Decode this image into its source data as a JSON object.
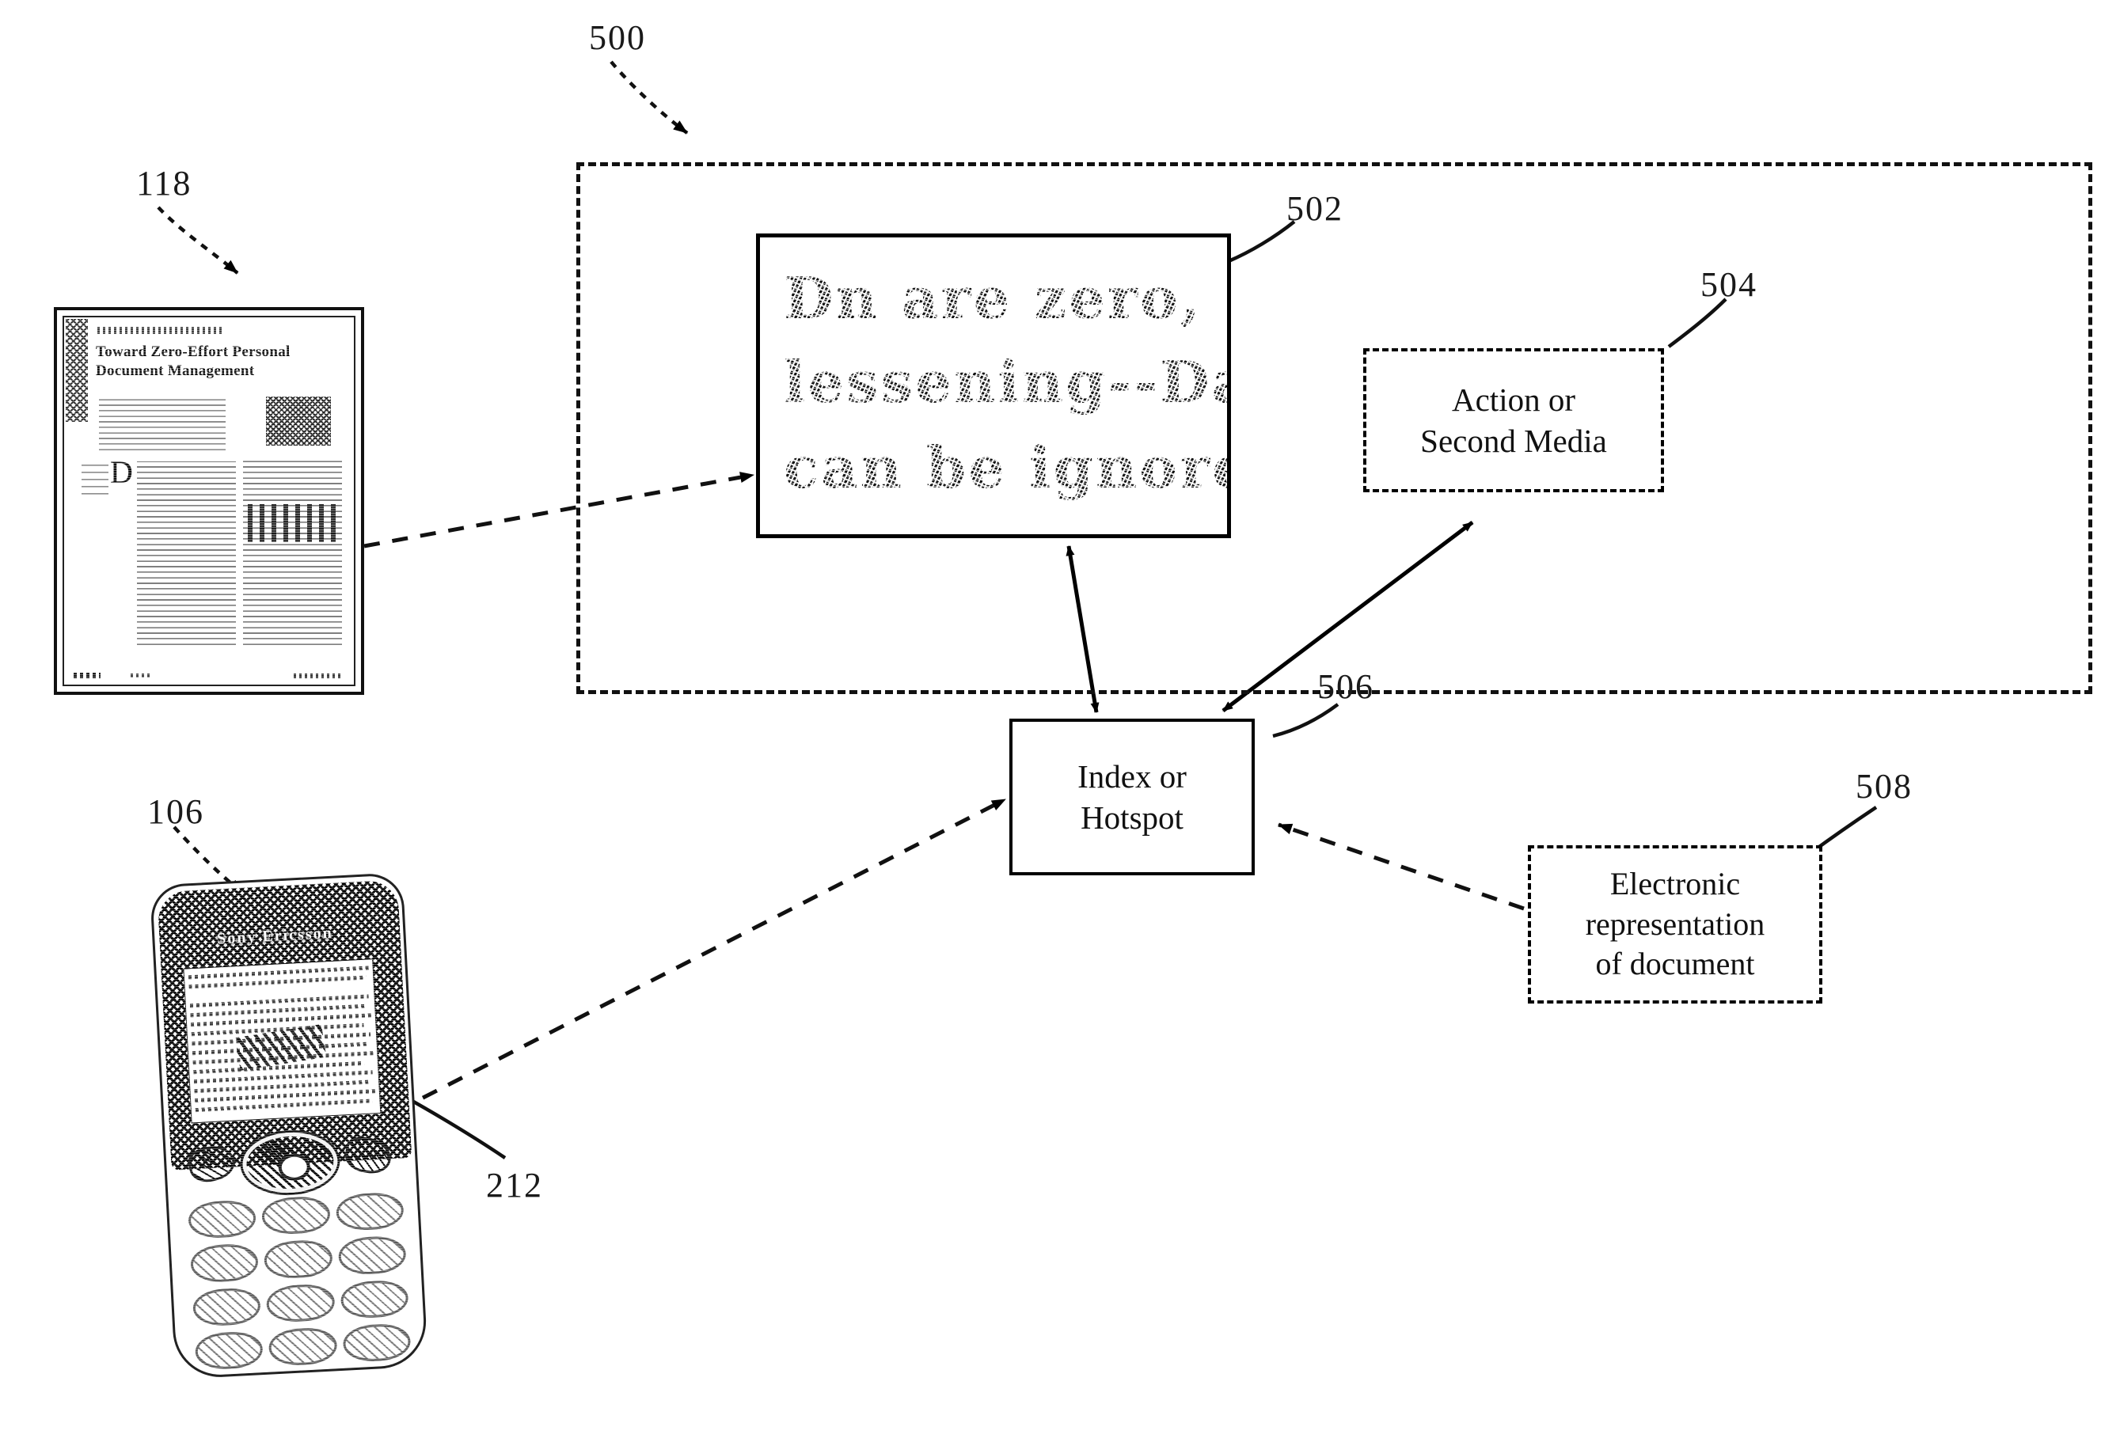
{
  "figure": {
    "reference_numerals": [
      {
        "id": "ref-500",
        "label": "500"
      },
      {
        "id": "ref-118",
        "label": "118"
      },
      {
        "id": "ref-502",
        "label": "502"
      },
      {
        "id": "ref-504",
        "label": "504"
      },
      {
        "id": "ref-506",
        "label": "506"
      },
      {
        "id": "ref-508",
        "label": "508"
      },
      {
        "id": "ref-106",
        "label": "106"
      },
      {
        "id": "ref-212",
        "label": "212"
      }
    ]
  },
  "system_boundary": {
    "numeral": "500",
    "style": "dashed"
  },
  "degraded_text_block": {
    "numeral": "502",
    "style": "solid",
    "lines": [
      "Dn are zero,",
      "lessening--Da",
      "can be ignore"
    ]
  },
  "action_box": {
    "numeral": "504",
    "style": "dashed",
    "lines": [
      "Action or",
      "Second Media"
    ]
  },
  "index_box": {
    "numeral": "506",
    "style": "solid",
    "lines": [
      "Index or",
      "Hotspot"
    ]
  },
  "electronic_box": {
    "numeral": "508",
    "style": "dashed",
    "lines": [
      "Electronic",
      "representation",
      "of document"
    ]
  },
  "paper_document": {
    "numeral": "118",
    "header": "COMPUTING PRACTICES",
    "title": "Toward Zero-Effort Personal Document Management",
    "dropcap": "D"
  },
  "phone": {
    "numeral": "106",
    "brand": "Sony Ericsson",
    "screen_numeral": "212"
  }
}
